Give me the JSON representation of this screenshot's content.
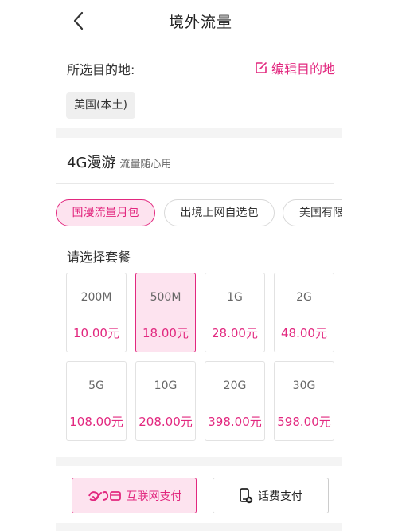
{
  "header": {
    "title": "境外流量"
  },
  "destination": {
    "label": "所选目的地:",
    "edit_label": "编辑目的地",
    "selected": "美国(本土)"
  },
  "roaming": {
    "title": "4G漫游",
    "subtitle": "流量随心用"
  },
  "tabs": [
    {
      "label": "国漫流量月包"
    },
    {
      "label": "出境上网自选包"
    },
    {
      "label": "美国有限"
    }
  ],
  "choose_label": "请选择套餐",
  "plans": [
    {
      "size": "200M",
      "price": "10.00元"
    },
    {
      "size": "500M",
      "price": "18.00元"
    },
    {
      "size": "1G",
      "price": "28.00元"
    },
    {
      "size": "2G",
      "price": "48.00元"
    },
    {
      "size": "5G",
      "price": "108.00元"
    },
    {
      "size": "10G",
      "price": "208.00元"
    },
    {
      "size": "20G",
      "price": "398.00元"
    },
    {
      "size": "30G",
      "price": "598.00元"
    }
  ],
  "payment": {
    "internet_label": "互联网支付",
    "phone_label": "话费支付"
  },
  "colors": {
    "accent": "#e2287f",
    "accent_bg": "#fde3ef",
    "band": "#f4f4f4"
  }
}
